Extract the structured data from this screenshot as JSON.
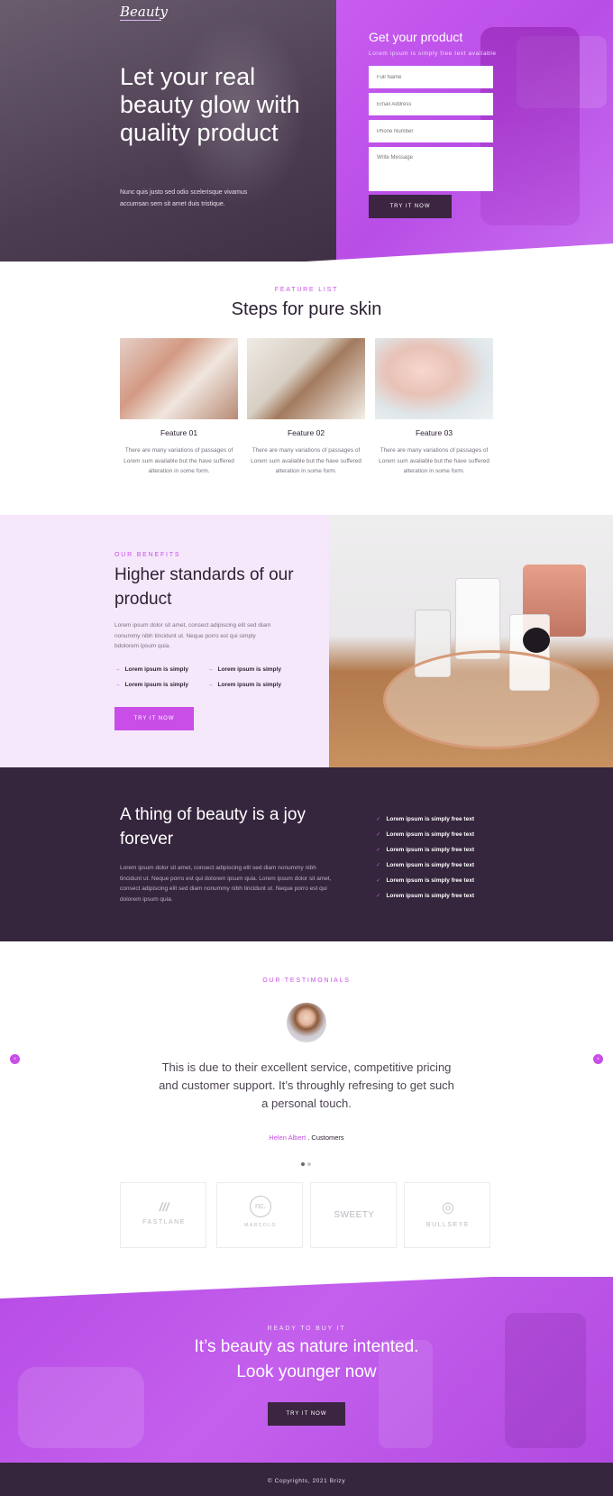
{
  "hero": {
    "logo": "Beauty",
    "title": "Let your real beauty glow with quality product",
    "text": "Nunc quis justo sed odio scelerisque vivamus accumsan sem sit amet duis tristique.",
    "form": {
      "title": "Get your product",
      "subtitle": "Lorem ipsum is simply free text available",
      "placeholders": {
        "name": "Full Name",
        "email": "Email Address",
        "phone": "Phone Number",
        "message": "Write Message"
      },
      "button": "TRY IT NOW"
    }
  },
  "features": {
    "eyebrow": "FEATURE LIST",
    "title": "Steps for pure skin",
    "items": [
      {
        "name": "Feature 01",
        "desc": "There are many variations of passages of Lorem sum available but the have suffered alteration in some form."
      },
      {
        "name": "Feature 02",
        "desc": "There are many variations of passages of Lorem sum available but the have suffered alteration in some form."
      },
      {
        "name": "Feature 03",
        "desc": "There are many variations of passages of Lorem sum available but the have suffered alteration in some form."
      }
    ]
  },
  "benefits": {
    "eyebrow": "OUR BENEFITS",
    "title": "Higher standards of our product",
    "text": "Lorem ipsum dolor sit amet, consect adipiscing elit sed diam nonummy nibh tincidunt ut. Neque porro est qui simply bdolorem ipsum quia.",
    "items": [
      "Lorem ipsum is simply",
      "Lorem ipsum is simply",
      "Lorem ipsum is simply",
      "Lorem ipsum is simply"
    ],
    "button": "TRY IT NOW"
  },
  "joy": {
    "title": "A thing of beauty is a joy forever",
    "text": "Lorem ipsum dolor sit amet, consect adipiscing elit sed diam nonummy nibh tincidunt ut. Neque porro est qui dolorem ipsum quia. Lorem ipsum dolor sit amet, consect adipiscing elit sed diam nonummy nibh tincidunt ut. Neque porro est qui dolorem ipsum quia.",
    "items": [
      "Lorem ipsum is simply free text",
      "Lorem ipsum is simply free text",
      "Lorem ipsum is simply free text",
      "Lorem ipsum is simply free text",
      "Lorem ipsum is simply free text",
      "Lorem ipsum is simply free text"
    ]
  },
  "testimonials": {
    "eyebrow": "OUR TESTIMONIALS",
    "quote": "This is due to their excellent service, competitive pricing and customer support. It’s throughly refresing to get such a personal touch.",
    "author": "Helen Albert",
    "separator": " . ",
    "role": "Customers",
    "prev_icon": "‹",
    "next_icon": "›"
  },
  "partners": [
    {
      "mark": "///",
      "name": "FASTLANE"
    },
    {
      "mark": "nc.",
      "name": "MARCOLO"
    },
    {
      "mark": "",
      "name": "SWEETY"
    },
    {
      "mark": "◎",
      "name": "BULLSEYE"
    }
  ],
  "cta": {
    "eyebrow": "READY TO BUY IT",
    "title_line1": "It’s beauty as nature intented.",
    "title_line2": "Look younger now",
    "button": "TRY IT NOW"
  },
  "footer": {
    "text": "© Copyrights, 2021 Brizy"
  },
  "colors": {
    "accent": "#c94ee8",
    "dark": "#35253d",
    "light_section": "#f6e8fb"
  }
}
